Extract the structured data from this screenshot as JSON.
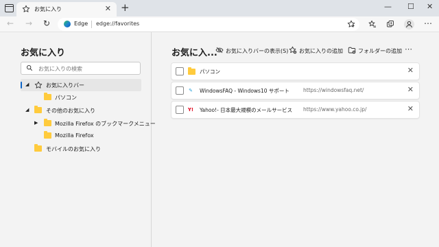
{
  "browser": {
    "tab_title": "お気に入り",
    "tab_close": "✕",
    "new_tab": "+",
    "window_controls": {
      "minimize": "—",
      "maximize": "☐",
      "close": "✕"
    },
    "site_name": "Edge",
    "url": "edge://favorites",
    "more": "⋯"
  },
  "sidebar": {
    "title": "お気に入り",
    "search_placeholder": "お気に入りの検索",
    "tree": [
      {
        "label": "お気に入りバー",
        "expanded": true,
        "selected": true,
        "level": 0
      },
      {
        "label": "パソコン",
        "level": 1
      },
      {
        "label": "その他のお気に入り",
        "expanded": true,
        "level": 0
      },
      {
        "label": "Mozilla Firefox のブックマークメニュー",
        "expanded": false,
        "level": 1
      },
      {
        "label": "Mozilla Firefox",
        "level": 1
      },
      {
        "label": "モバイルのお気に入り",
        "level": 0
      }
    ]
  },
  "main": {
    "title": "お気に入...",
    "actions": {
      "show_bar": "お気に入りバーの表示(S)",
      "add_favorite": "お気に入りの追加",
      "add_folder": "フォルダーの追加",
      "more": "⋯"
    },
    "items": [
      {
        "type": "folder",
        "name": "パソコン",
        "url": ""
      },
      {
        "type": "link",
        "name": "WindowsFAQ - Windows10 サポート",
        "url": "https://windowsfaq.net/",
        "favicon": "✎",
        "favicon_color": "#2aa0d8"
      },
      {
        "type": "link",
        "name": "Yahoo!- 日本最大規模のメールサービス",
        "url": "https://www.yahoo.co.jp/",
        "favicon": "Y!",
        "favicon_color": "#e0001b"
      }
    ],
    "remove_icon": "✕"
  },
  "colors": {
    "accent": "#0b63c6",
    "folder": "#ffcb3d",
    "titlebar": "#dfe3e8",
    "page_bg": "#f3f3f3"
  }
}
